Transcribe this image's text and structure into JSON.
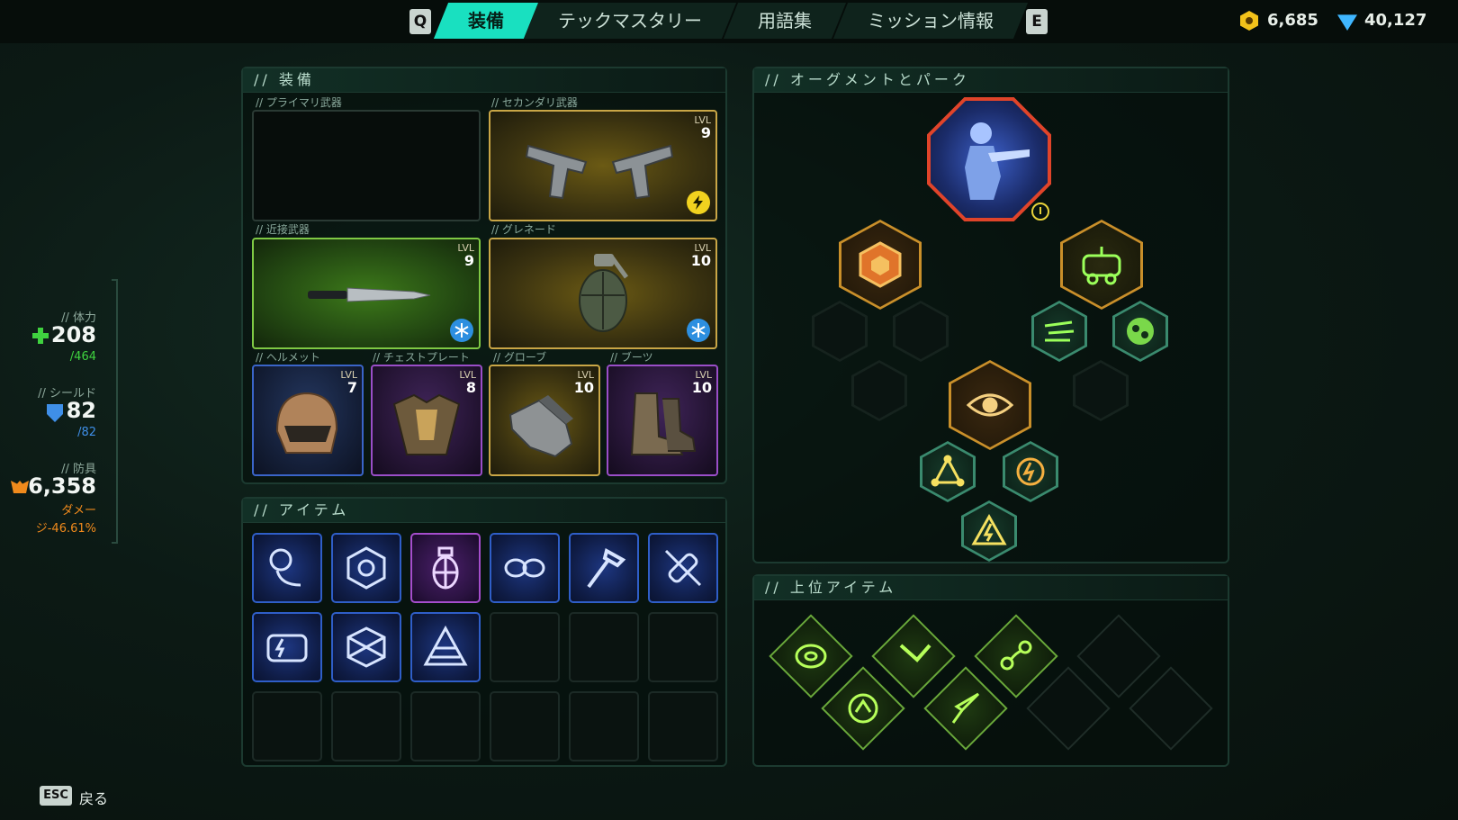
{
  "topbar": {
    "key_left": "Q",
    "key_right": "E",
    "tabs": [
      {
        "label": "装備",
        "active": true
      },
      {
        "label": "テックマスタリー",
        "active": false
      },
      {
        "label": "用語集",
        "active": false
      },
      {
        "label": "ミッション情報",
        "active": false
      }
    ],
    "coins": "6,685",
    "gems": "40,127"
  },
  "stats": {
    "health_label": "// 体力",
    "health_value": "208",
    "health_max": "/464",
    "shield_label": "// シールド",
    "shield_value": "82",
    "shield_max": "/82",
    "armor_label": "// 防具",
    "armor_value": "6,358",
    "armor_sub1": "ダメー",
    "armor_sub2": "ジ-46.61%"
  },
  "equipment": {
    "title": "// 装備",
    "lvl_label": "LVL",
    "primary_label": "// プライマリ武器",
    "secondary_label": "// セカンダリ武器",
    "secondary_level": "9",
    "melee_label": "// 近接武器",
    "melee_level": "9",
    "grenade_label": "// グレネード",
    "grenade_level": "10",
    "helmet_label": "// ヘルメット",
    "helmet_level": "7",
    "chest_label": "// チェストプレート",
    "chest_level": "8",
    "gloves_label": "// グローブ",
    "gloves_level": "10",
    "boots_label": "// ブーツ",
    "boots_level": "10"
  },
  "items": {
    "title": "// アイテム",
    "icons": [
      "chain-icon",
      "shell-icon",
      "grenade-icon",
      "goggles-icon",
      "hammer-icon",
      "bandage-icon",
      "battery-icon",
      "crate-icon",
      "pyramid-icon"
    ]
  },
  "augments": {
    "title": "// オーグメントとパーク"
  },
  "top_items": {
    "title": "// 上位アイテム"
  },
  "footer": {
    "esc_key": "ESC",
    "back_label": "戻る"
  },
  "colors": {
    "accent": "#19e0c0",
    "gold": "#c9a646",
    "green": "#7fc944",
    "blue": "#3a64c8",
    "purple": "#9a4ec8",
    "armor": "#f08a1c",
    "health": "#3fd23f"
  }
}
